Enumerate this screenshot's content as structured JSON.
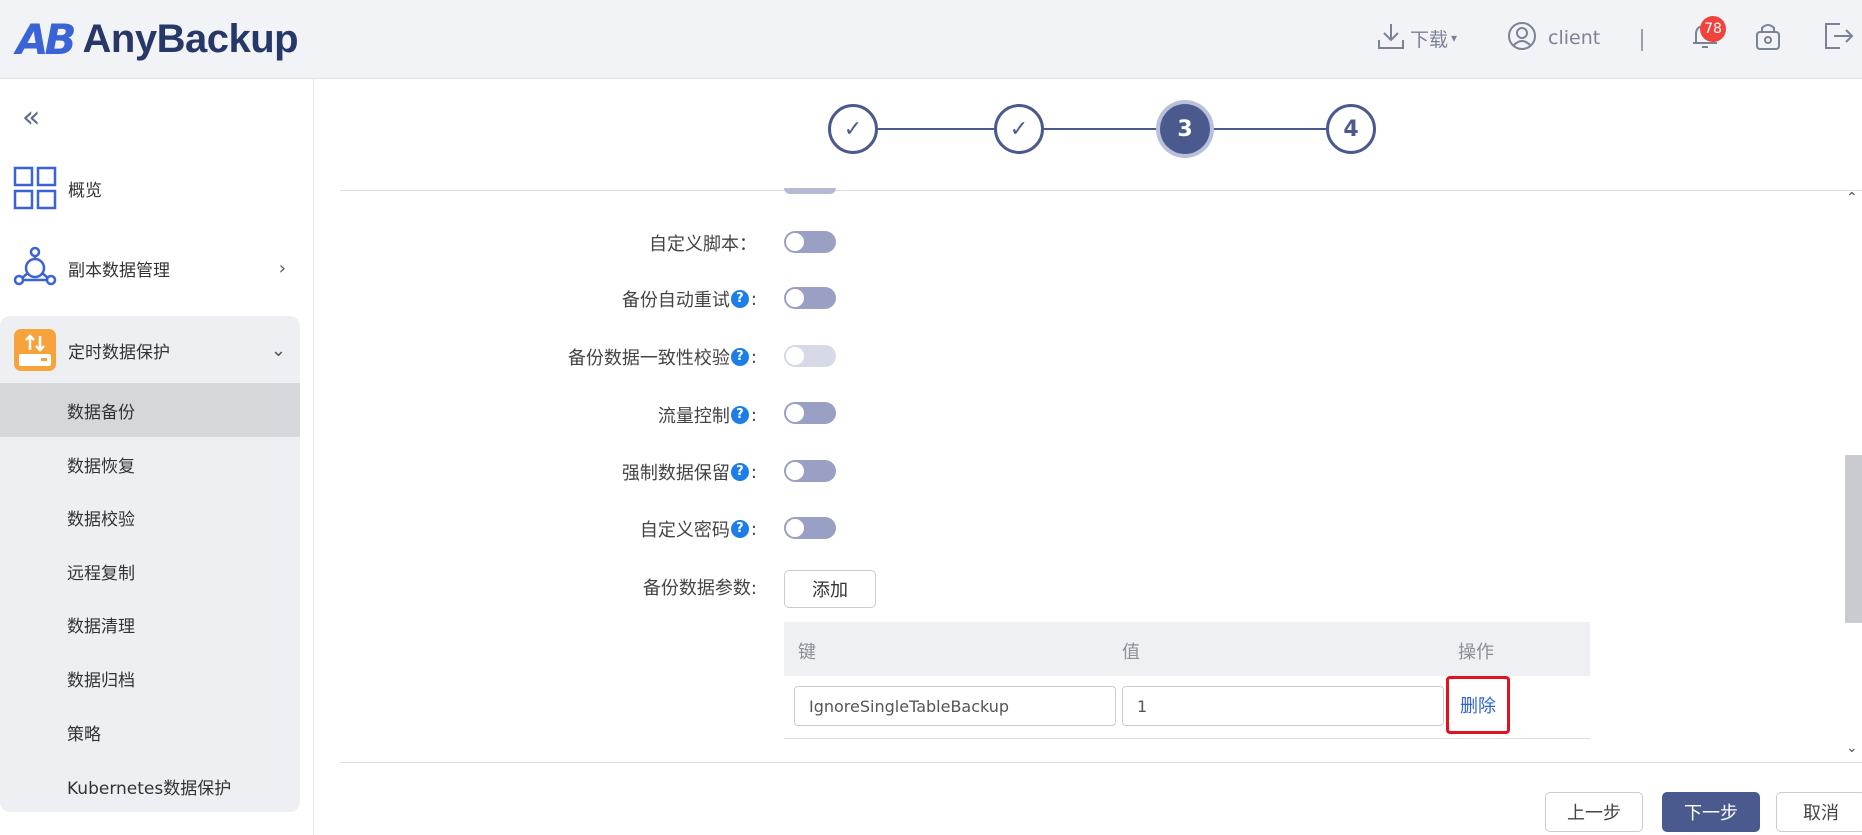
{
  "header": {
    "logo_mark": "AB",
    "logo_text": "AnyBackup",
    "download_label": "下载",
    "user_label": "client",
    "notification_count": "78",
    "accent_color": "#263768"
  },
  "sidebar": {
    "collapse_symbol": "«",
    "items": [
      {
        "label": "概览",
        "icon": "grid-icon"
      },
      {
        "label": "副本数据管理",
        "icon": "network-icon",
        "chevron": "›"
      },
      {
        "label": "定时数据保护",
        "icon": "backup-drive-icon",
        "chevron": "⌄"
      }
    ],
    "sub_items": [
      "数据备份",
      "数据恢复",
      "数据校验",
      "远程复制",
      "数据清理",
      "数据归档",
      "策略",
      "Kubernetes数据保护"
    ],
    "active_sub": "数据备份"
  },
  "stepper": {
    "steps": [
      {
        "label": "✓",
        "state": "done"
      },
      {
        "label": "✓",
        "state": "done"
      },
      {
        "label": "3",
        "state": "current"
      },
      {
        "label": "4",
        "state": "todo"
      }
    ]
  },
  "form": {
    "rows": [
      {
        "label": "自定义脚本：",
        "help": false,
        "toggle": "off"
      },
      {
        "label": "备份自动重试",
        "help": true,
        "suffix": ":",
        "toggle": "off"
      },
      {
        "label": "备份数据一致性校验",
        "help": true,
        "suffix": ":",
        "toggle": "disabled"
      },
      {
        "label": "流量控制",
        "help": true,
        "suffix": ":",
        "toggle": "off"
      },
      {
        "label": "强制数据保留",
        "help": true,
        "suffix": ":",
        "toggle": "off"
      },
      {
        "label": "自定义密码 ",
        "help": true,
        "suffix": ":",
        "toggle": "off"
      }
    ],
    "params_label": "备份数据参数:",
    "add_button": "添加",
    "help_glyph": "?"
  },
  "table": {
    "headers": {
      "key": "键",
      "value": "值",
      "action": "操作"
    },
    "rows": [
      {
        "key": "IgnoreSingleTableBackup",
        "value": "1",
        "action": "删除"
      }
    ]
  },
  "footer": {
    "prev": "上一步",
    "next": "下一步",
    "cancel": "取消"
  }
}
